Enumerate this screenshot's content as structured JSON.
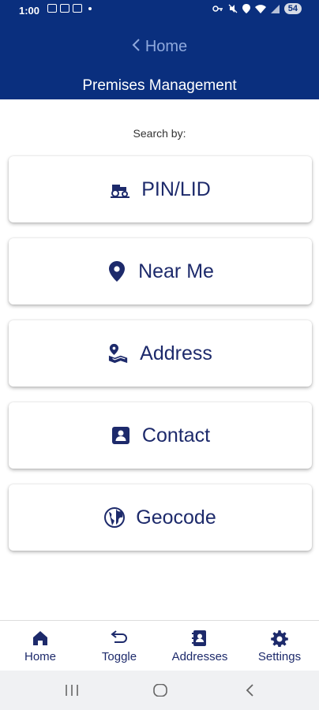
{
  "status_bar": {
    "time": "1:00",
    "battery": "54"
  },
  "header": {
    "back_label": "Home",
    "title": "Premises Management"
  },
  "search": {
    "label": "Search by:",
    "options": [
      {
        "label": "PIN/LID",
        "icon": "tractor-icon"
      },
      {
        "label": "Near Me",
        "icon": "location-pin-icon"
      },
      {
        "label": "Address",
        "icon": "map-address-icon"
      },
      {
        "label": "Contact",
        "icon": "contact-card-icon"
      },
      {
        "label": "Geocode",
        "icon": "globe-icon"
      }
    ]
  },
  "bottom_nav": {
    "items": [
      {
        "label": "Home",
        "icon": "home-icon"
      },
      {
        "label": "Toggle",
        "icon": "toggle-arrows-icon"
      },
      {
        "label": "Addresses",
        "icon": "address-book-icon"
      },
      {
        "label": "Settings",
        "icon": "gear-icon"
      }
    ]
  },
  "colors": {
    "header_bg": "#0a2f7e",
    "text_primary": "#1d2a6b",
    "back_link": "#8fa9dd"
  }
}
